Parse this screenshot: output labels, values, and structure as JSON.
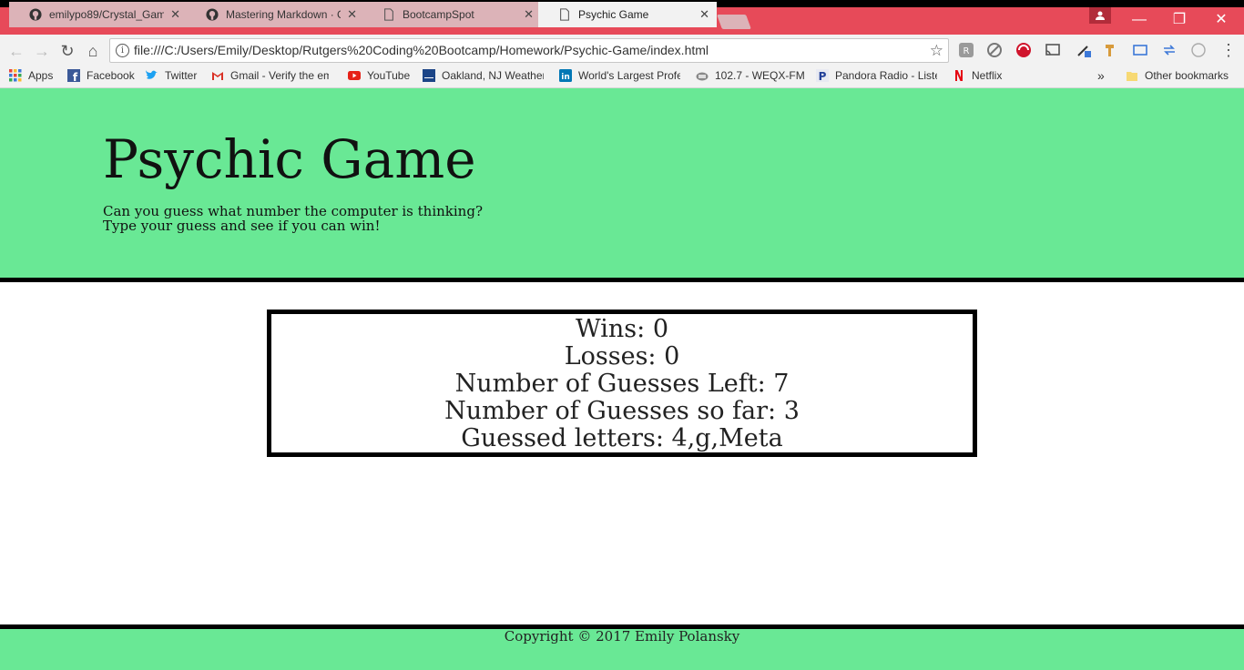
{
  "browser": {
    "tabs": [
      {
        "title": "emilypo89/Crystal_Game",
        "icon": "github-icon",
        "active": false
      },
      {
        "title": "Mastering Markdown · G",
        "icon": "github-icon",
        "active": false
      },
      {
        "title": "BootcampSpot",
        "icon": "page-icon",
        "active": false
      },
      {
        "title": "Psychic Game",
        "icon": "page-icon",
        "active": true
      }
    ],
    "close_glyph": "✕",
    "url": "file:///C:/Users/Emily/Desktop/Rutgers%20Coding%20Bootcamp/Homework/Psychic-Game/index.html",
    "bookmarks": [
      {
        "label": "Apps",
        "icon": "apps-grid-icon",
        "color": "#e8453c"
      },
      {
        "label": "Facebook",
        "icon": "facebook-icon",
        "color": "#3b5998"
      },
      {
        "label": "Twitter",
        "icon": "twitter-icon",
        "color": "#1da1f2"
      },
      {
        "label": "Gmail - Verify the em",
        "icon": "gmail-icon",
        "color": "#d93025"
      },
      {
        "label": "YouTube",
        "icon": "youtube-icon",
        "color": "#e62117"
      },
      {
        "label": "Oakland, NJ Weather",
        "icon": "weather-channel-icon",
        "color": "#1c4587"
      },
      {
        "label": "World's Largest Profe",
        "icon": "linkedin-icon",
        "color": "#0077b5"
      },
      {
        "label": "102.7 - WEQX-FM",
        "icon": "radio-icon",
        "color": "#666666"
      },
      {
        "label": "Pandora Radio - Liste",
        "icon": "pandora-icon",
        "color": "#224099"
      },
      {
        "label": "Netflix",
        "icon": "netflix-icon",
        "color": "#e50914"
      }
    ],
    "overflow_chevron": "»",
    "other_bookmarks": "Other bookmarks",
    "tabstrip_color": "#e74a59"
  },
  "page": {
    "title": "Psychic Game",
    "subtitle_line1": "Can you guess what number the computer is thinking?",
    "subtitle_line2": "Type your guess and see if you can win!",
    "scores": {
      "wins": "Wins: 0",
      "losses": "Losses: 0",
      "guesses_left": "Number of Guesses Left: 7",
      "guesses_so_far": "Number of Guesses so far: 3",
      "guessed_letters": "Guessed letters: 4,g,Meta"
    },
    "footer": "Copyright © 2017 Emily Polansky",
    "accent_color": "#69e895"
  }
}
